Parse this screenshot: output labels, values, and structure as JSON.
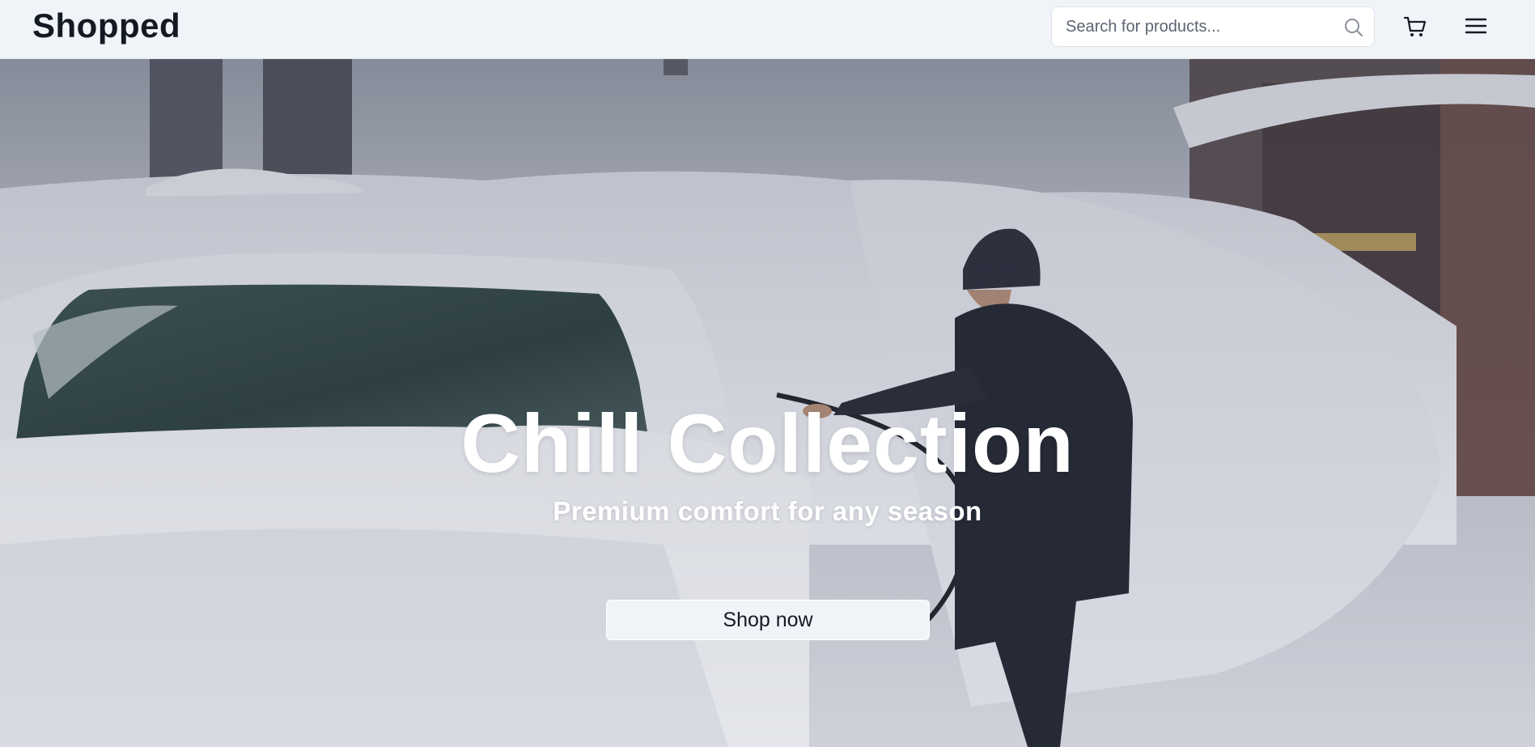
{
  "header": {
    "logo_text": "Shopped",
    "search": {
      "placeholder": "Search for products...",
      "value": ""
    },
    "icons": [
      "search-icon",
      "cart-icon",
      "menu-icon"
    ]
  },
  "hero": {
    "title": "Chill Collection",
    "subtitle": "Premium comfort for any season",
    "cta_label": "Shop now",
    "image_description": "winter scene"
  },
  "colors": {
    "header_bg": "#f0f3f8",
    "text_dark": "#141a24",
    "hero_text": "#ffffff",
    "button_bg": "#f0f3f8"
  }
}
